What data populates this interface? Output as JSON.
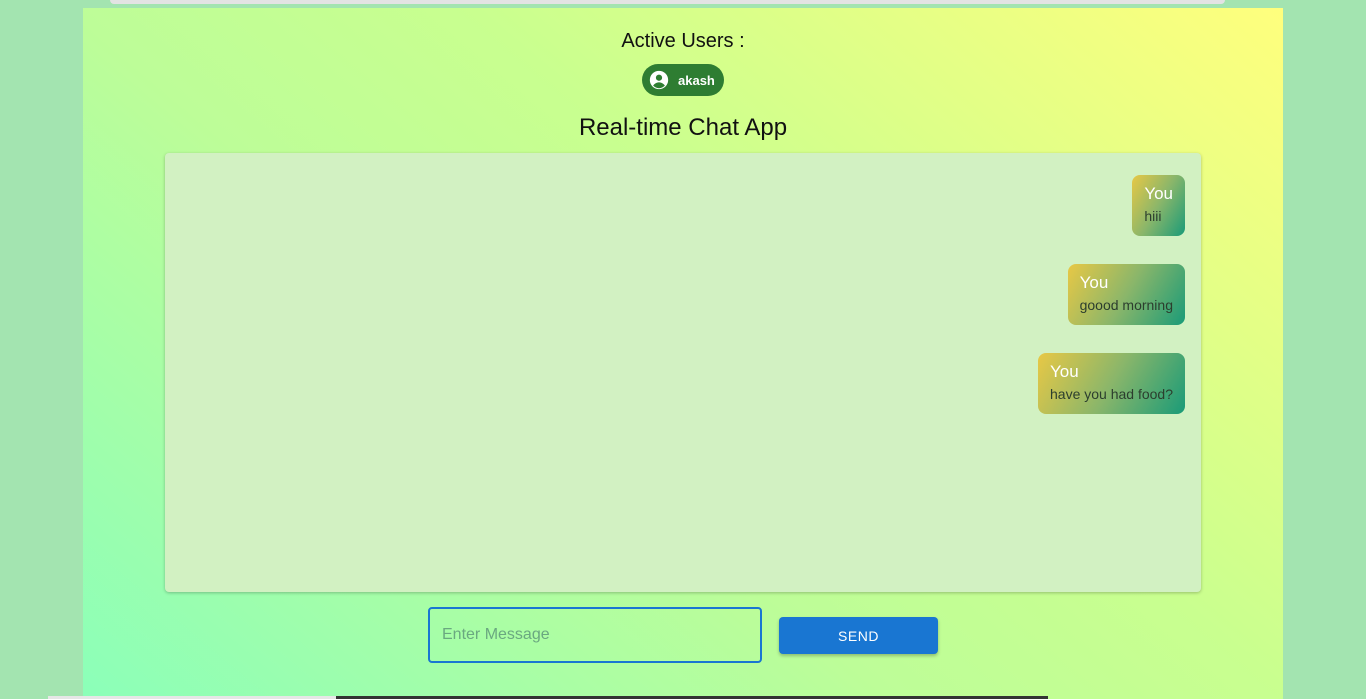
{
  "active_users": {
    "title": "Active Users :",
    "users": [
      {
        "name": "akash",
        "icon": "account-circle-icon"
      }
    ]
  },
  "app": {
    "title": "Real-time Chat App"
  },
  "messages": [
    {
      "sender": "You",
      "text": "hiii"
    },
    {
      "sender": "You",
      "text": "goood morning"
    },
    {
      "sender": "You",
      "text": "have you had food?"
    }
  ],
  "composer": {
    "placeholder": "Enter Message",
    "value": "",
    "send_label": "SEND"
  },
  "colors": {
    "chip": "#2e7d32",
    "primary": "#1976d2",
    "chat_background": "#d2f1c2"
  }
}
